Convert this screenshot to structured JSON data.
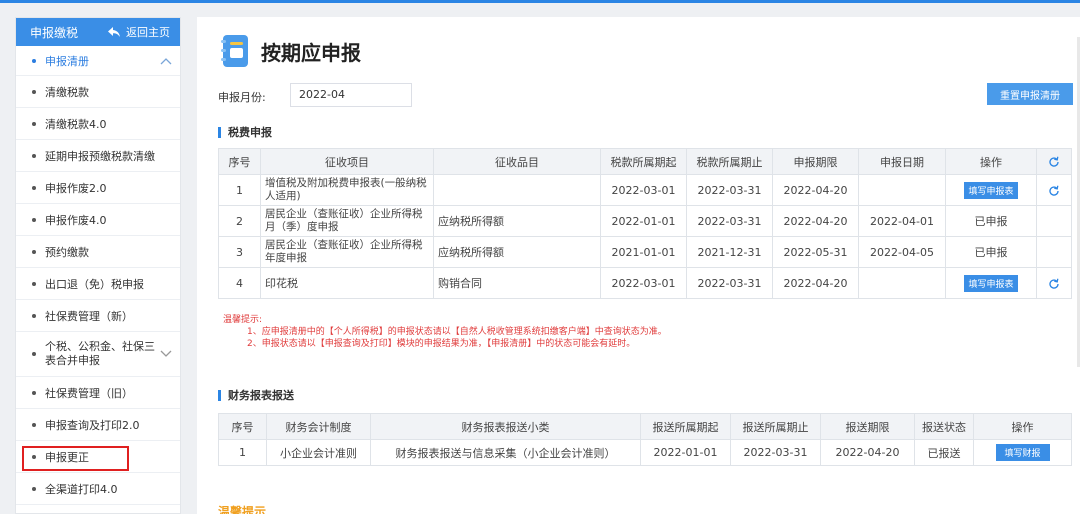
{
  "sidebar": {
    "title": "申报缴税",
    "back_label": "返回主页",
    "items": [
      {
        "label": "申报清册"
      },
      {
        "label": "清缴税款"
      },
      {
        "label": "清缴税款4.0"
      },
      {
        "label": "延期申报预缴税款清缴"
      },
      {
        "label": "申报作废2.0"
      },
      {
        "label": "申报作废4.0"
      },
      {
        "label": "预约缴款"
      },
      {
        "label": "出口退（免）税申报"
      },
      {
        "label": "社保费管理（新）"
      },
      {
        "label": "个税、公积金、社保三表合并申报"
      },
      {
        "label": "社保费管理（旧）"
      },
      {
        "label": "申报查询及打印2.0"
      },
      {
        "label": "申报更正"
      },
      {
        "label": "全渠道打印4.0"
      }
    ]
  },
  "main": {
    "title": "按期应申报",
    "month_label": "申报月份:",
    "month_value": "2022-04",
    "reset_button": "重置申报清册",
    "tax_section": {
      "title": "税费申报",
      "headers": [
        "序号",
        "征收项目",
        "征收品目",
        "税款所属期起",
        "税款所属期止",
        "申报期限",
        "申报日期",
        "操作"
      ],
      "rows": [
        {
          "no": "1",
          "item": "增值税及附加税费申报表(一般纳税人适用)",
          "sub": "",
          "start": "2022-03-01",
          "end": "2022-03-31",
          "deadline": "2022-04-20",
          "date": "",
          "op": "填写申报表",
          "op_type": "button"
        },
        {
          "no": "2",
          "item": "居民企业（查账征收）企业所得税月（季）度申报",
          "sub": "应纳税所得额",
          "start": "2022-01-01",
          "end": "2022-03-31",
          "deadline": "2022-04-20",
          "date": "2022-04-01",
          "op": "已申报",
          "op_type": "text"
        },
        {
          "no": "3",
          "item": "居民企业（查账征收）企业所得税年度申报",
          "sub": "应纳税所得额",
          "start": "2021-01-01",
          "end": "2021-12-31",
          "deadline": "2022-05-31",
          "date": "2022-04-05",
          "op": "已申报",
          "op_type": "text"
        },
        {
          "no": "4",
          "item": "印花税",
          "sub": "购销合同",
          "start": "2022-03-01",
          "end": "2022-03-31",
          "deadline": "2022-04-20",
          "date": "",
          "op": "填写申报表",
          "op_type": "button"
        }
      ]
    },
    "notice": {
      "title": "温馨提示:",
      "lines": [
        "1、应申报清册中的【个人所得税】的申报状态请以【自然人税收管理系统扣缴客户端】中查询状态为准。",
        "2、申报状态请以【申报查询及打印】模块的申报结果为准，【申报清册】中的状态可能会有延时。"
      ]
    },
    "finance_section": {
      "title": "财务报表报送",
      "headers": [
        "序号",
        "财务会计制度",
        "财务报表报送小类",
        "报送所属期起",
        "报送所属期止",
        "报送期限",
        "报送状态",
        "操作"
      ],
      "rows": [
        {
          "no": "1",
          "system": "小企业会计准则",
          "type": "财务报表报送与信息采集（小企业会计准则）",
          "start": "2022-01-01",
          "end": "2022-03-31",
          "deadline": "2022-04-20",
          "status": "已报送",
          "op": "填写财报"
        }
      ]
    },
    "bottom_title": "温馨提示"
  },
  "colors": {
    "accent": "#3a8ee6",
    "warning": "#e03c3c",
    "highlight": "#e02020"
  }
}
